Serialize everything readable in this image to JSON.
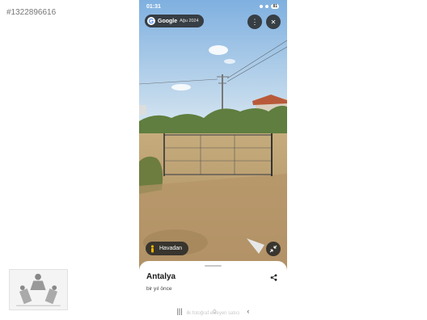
{
  "listing": {
    "id_text": "#1322896616"
  },
  "phone": {
    "status": {
      "time": "01:31",
      "battery": "81"
    },
    "google_chip": {
      "brand": "Google",
      "date": "Ağu 2024"
    },
    "controls": {
      "more_icon": "more-vertical-icon",
      "close_icon": "close-icon",
      "expand_icon": "collapse-arrows-icon",
      "share_icon": "share-icon"
    },
    "aerial_button": {
      "label": "Havadan",
      "icon": "person-icon"
    },
    "sheet": {
      "place_name": "Antalya",
      "time_ago": "bir yıl önce"
    },
    "navbar": {
      "recent": "|||",
      "home": "○",
      "back": "‹"
    },
    "watermark": "ilk fotoğraf ekleyen satıcı"
  },
  "colors": {
    "sky": "#9cc3e6",
    "chip_bg": "#282828",
    "sheet_bg": "#ffffff",
    "grass": "#b89a6a"
  }
}
